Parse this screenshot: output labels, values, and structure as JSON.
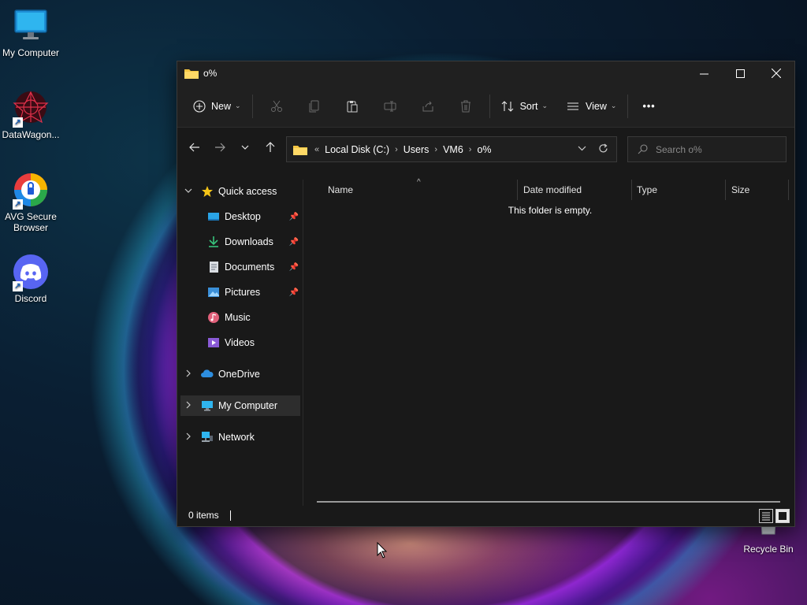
{
  "desktop": {
    "icons": [
      {
        "label": "My Computer"
      },
      {
        "label": "DataWagon..."
      },
      {
        "label": "AVG Secure Browser"
      },
      {
        "label": "Discord"
      },
      {
        "label": "Recycle Bin"
      }
    ]
  },
  "window": {
    "title": "o%",
    "toolbar": {
      "new_label": "New",
      "sort_label": "Sort",
      "view_label": "View",
      "more_label": "•••"
    },
    "address": {
      "overflow": "«",
      "crumbs": [
        "Local Disk (C:)",
        "Users",
        "VM6",
        "o%"
      ]
    },
    "search": {
      "placeholder": "Search o%"
    },
    "nav": {
      "quick_access": "Quick access",
      "items": [
        {
          "label": "Desktop"
        },
        {
          "label": "Downloads"
        },
        {
          "label": "Documents"
        },
        {
          "label": "Pictures"
        },
        {
          "label": "Music"
        },
        {
          "label": "Videos"
        }
      ],
      "onedrive": "OneDrive",
      "my_computer": "My Computer",
      "network": "Network"
    },
    "columns": [
      "Name",
      "Date modified",
      "Type",
      "Size"
    ],
    "empty_message": "This folder is empty.",
    "status": "0 items"
  }
}
